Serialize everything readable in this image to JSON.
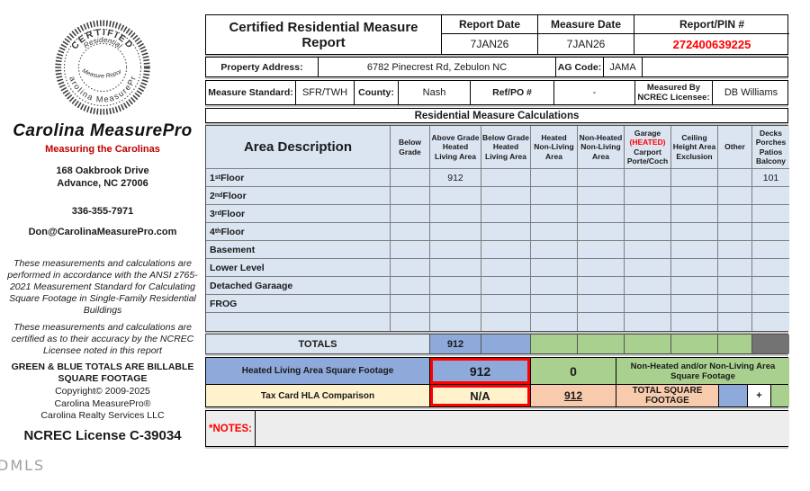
{
  "header": {
    "title": "Certified Residential Measure Report",
    "report_date_label": "Report Date",
    "report_date": "7JAN26",
    "measure_date_label": "Measure Date",
    "measure_date": "7JAN26",
    "pin_label": "Report/PIN #",
    "pin_value": "272400639225"
  },
  "property": {
    "address_label": "Property Address:",
    "address_value": "6782 Pinecrest Rd, Zebulon NC",
    "ag_code_label": "AG Code:",
    "ag_code_value": "JAMA"
  },
  "standard": {
    "measure_standard_label": "Measure Standard:",
    "measure_standard_value": "SFR/TWH",
    "county_label": "County:",
    "county_value": "Nash",
    "ref_po_label": "Ref/PO #",
    "ref_po_value": "-",
    "measured_by_label": "Measured By NCREC Licensee:",
    "measured_by_value": "DB Williams"
  },
  "calc": {
    "section_title": "Residential Measure Calculations",
    "area_header": "Area Description",
    "columns": {
      "below_grade": "Below Grade",
      "above_grade_hla": "Above Grade Heated Living Area",
      "below_grade_hla": "Below Grade Heated Living Area",
      "heated_nla": "Heated Non-Living Area",
      "non_heated_nla": "Non-Heated Non-Living Area",
      "garage_line1": "Garage",
      "garage_line2": "(HEATED)",
      "garage_line3": "Carport Porte/Coch",
      "ceiling": "Ceiling Height Area Exclusion",
      "other": "Other",
      "decks": "Decks Porches Patios Balcony"
    },
    "rows": [
      {
        "name": "1",
        "sup": "st",
        "rest": " Floor",
        "above_grade_hla": "912",
        "decks": "101"
      },
      {
        "name": "2",
        "sup": "nd",
        "rest": " Floor",
        "above_grade_hla": "",
        "decks": ""
      },
      {
        "name": "3",
        "sup": "rd",
        "rest": " Floor",
        "above_grade_hla": "",
        "decks": ""
      },
      {
        "name": "4",
        "sup": "th",
        "rest": " Floor",
        "above_grade_hla": "",
        "decks": ""
      },
      {
        "name": "Basement",
        "sup": "",
        "rest": "",
        "above_grade_hla": "",
        "decks": ""
      },
      {
        "name": "Lower Level",
        "sup": "",
        "rest": "",
        "above_grade_hla": "",
        "decks": ""
      },
      {
        "name": "Detached Garaage",
        "sup": "",
        "rest": "",
        "above_grade_hla": "",
        "decks": ""
      },
      {
        "name": "FROG",
        "sup": "",
        "rest": "",
        "above_grade_hla": "",
        "decks": ""
      },
      {
        "name": "",
        "sup": "",
        "rest": "",
        "above_grade_hla": "",
        "decks": ""
      }
    ],
    "totals_label": "TOTALS",
    "totals_above_grade_hla": "912"
  },
  "summary": {
    "hla_label": "Heated Living Area Square Footage",
    "hla_value": "912",
    "hla_secondary": "0",
    "non_heated_label": "Non-Heated and/or Non-Living Area Square Footage",
    "tax_label": "Tax Card HLA Comparison",
    "tax_value": "N/A",
    "total_value": "912",
    "total_label": "TOTAL SQUARE FOOTAGE",
    "plus_sign": "+"
  },
  "notes": {
    "label": "*NOTES:",
    "content": ""
  },
  "sidebar": {
    "seal_top": "CERTIFIED",
    "seal_second": "Residential",
    "seal_middle": "Measure Report",
    "seal_bottom": "Carolina MeasurePro",
    "brand": "Carolina MeasurePro",
    "tagline": "Measuring the Carolinas",
    "address_line1": "168 Oakbrook Drive",
    "address_line2": "Advance, NC  27006",
    "phone": "336-355-7971",
    "email": "Don@CarolinaMeasurePro.com",
    "disclaimer1": "These measurements and calculations are performed in accordance with the ANSI z765-2021 Measurement Standard for Calculating Square Footage in Single-Family Residential Buildings",
    "disclaimer2": "These measurements and calculations are certified as to their accuracy by the NCREC Licensee noted in this report",
    "billable_note": "GREEN & BLUE TOTALS ARE BILLABLE SQUARE FOOTAGE",
    "copyright": "Copyright© 2009-2025",
    "company_line1": "Carolina MeasurePro®",
    "company_line2": "Carolina Realty Services LLC",
    "license": "NCREC License C-39034"
  },
  "watermark": "DMLS",
  "colors": {
    "light_blue": "#dbe4f1",
    "medium_blue": "#8eaadb",
    "green": "#a9d08e",
    "gray_cell": "#737373",
    "cream": "#fff2cc",
    "peach": "#f8cbad",
    "red": "#ff0000",
    "brand_red": "#c00000"
  }
}
